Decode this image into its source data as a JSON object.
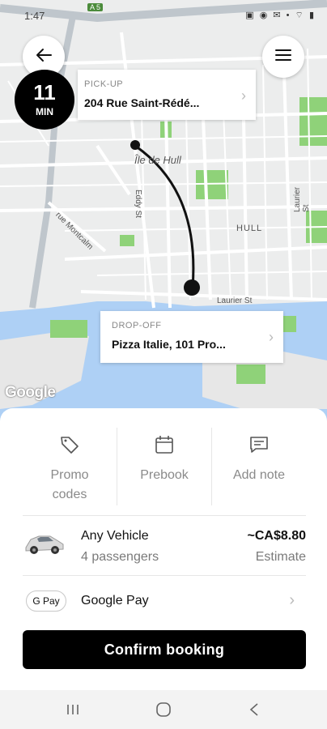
{
  "status_bar": {
    "time": "1:47",
    "icons": "▣ ◉ ✉ • ⌔ ▮"
  },
  "map": {
    "eta": {
      "value": "11",
      "unit": "MIN"
    },
    "labels": {
      "ile_de_hull": "Île de Hull",
      "hull": "HULL",
      "eddy_st": "Eddy St",
      "laurier_st": "Laurier St",
      "laurier_st_2": "Laurier St",
      "rue_montcalm": "rue Montcalm",
      "a5": "A 5"
    },
    "google_logo": "Google"
  },
  "pickup": {
    "label": "PICK-UP",
    "address": "204 Rue Saint-Rédé..."
  },
  "dropoff": {
    "label": "DROP-OFF",
    "address": "Pizza Italie, 101 Pro..."
  },
  "options": [
    {
      "label": "Promo codes",
      "icon": "tag-icon"
    },
    {
      "label": "Prebook",
      "icon": "calendar-icon"
    },
    {
      "label": "Add note",
      "icon": "chat-icon"
    }
  ],
  "vehicle": {
    "name": "Any Vehicle",
    "capacity": "4 passengers",
    "price": "~CA$8.80",
    "price_note": "Estimate"
  },
  "payment": {
    "badge": "G Pay",
    "label": "Google Pay"
  },
  "confirm_label": "Confirm booking",
  "colors": {
    "accent": "#000000",
    "park": "#8fd279",
    "water": "#aed0f5",
    "road": "#ffffff"
  }
}
